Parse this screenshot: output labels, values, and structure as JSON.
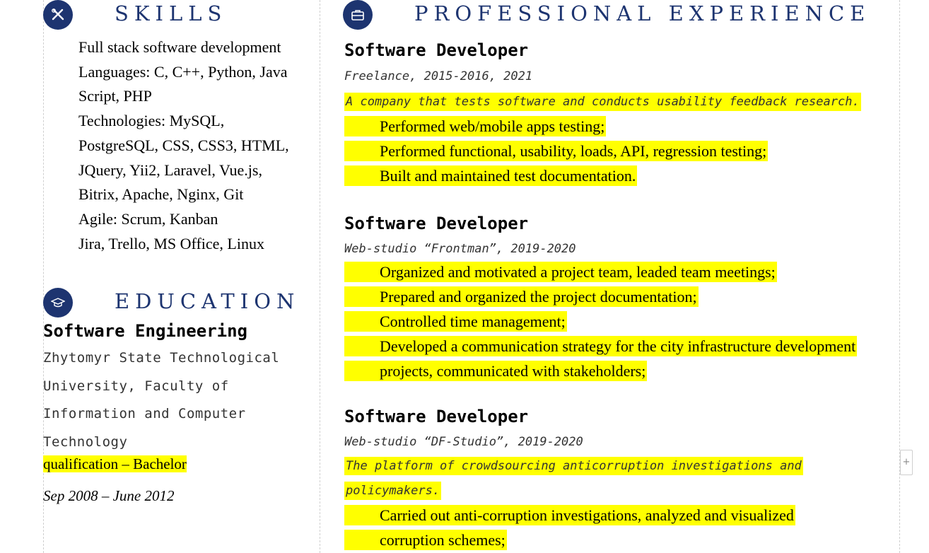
{
  "skills": {
    "title": "SKILLS",
    "icon": "tools-icon",
    "items": [
      "Full stack software development",
      "Languages:  C, C++, Python, Java",
      "Script, PHP",
      "Technologies: MySQL,",
      "PostgreSQL, CSS, CSS3, HTML,",
      "JQuery, Yii2, Laravel, Vue.js,",
      "Bitrix, Apache, Nginx, Git",
      "Agile: Scrum, Kanban",
      "Jira, Trello, MS Office, Linux"
    ]
  },
  "education": {
    "title": "EDUCATION",
    "icon": "graduation-cap-icon",
    "degree": "Software Engineering",
    "institution_lines": [
      "Zhytomyr State Technological",
      "University, Faculty of",
      "Information and Computer",
      "Technology"
    ],
    "qualification": "qualification – Bachelor",
    "dates": "Sep 2008 – June 2012"
  },
  "experience": {
    "title": "PROFESSIONAL EXPERIENCE",
    "icon": "briefcase-icon",
    "jobs": [
      {
        "title": "Software Developer",
        "company": "Freelance, 2015-2016, 2021",
        "description": [
          "A company that tests software and conducts usability feedback research."
        ],
        "bullets": [
          "Performed web/mobile apps testing;",
          "Performed functional, usability, loads, API, regression testing;",
          "Built and maintained test documentation."
        ]
      },
      {
        "title": "Software Developer",
        "company": "Web-studio “Frontman”, 2019-2020",
        "description": [],
        "bullets": [
          "Organized and motivated a project team, leaded team meetings;",
          "Prepared and organized the project documentation;",
          "Controlled time management;",
          "Developed a communication strategy for the city infrastructure development",
          "projects, communicated with stakeholders;"
        ]
      },
      {
        "title": "Software Developer",
        "company": "Web-studio “DF-Studio”, 2019-2020",
        "description": [
          "The platform of crowdsourcing anticorruption investigations and",
          "policymakers."
        ],
        "bullets": [
          "Carried out anti-corruption investigations, analyzed and visualized",
          "corruption schemes;"
        ]
      }
    ]
  },
  "scroll_plus": "+"
}
